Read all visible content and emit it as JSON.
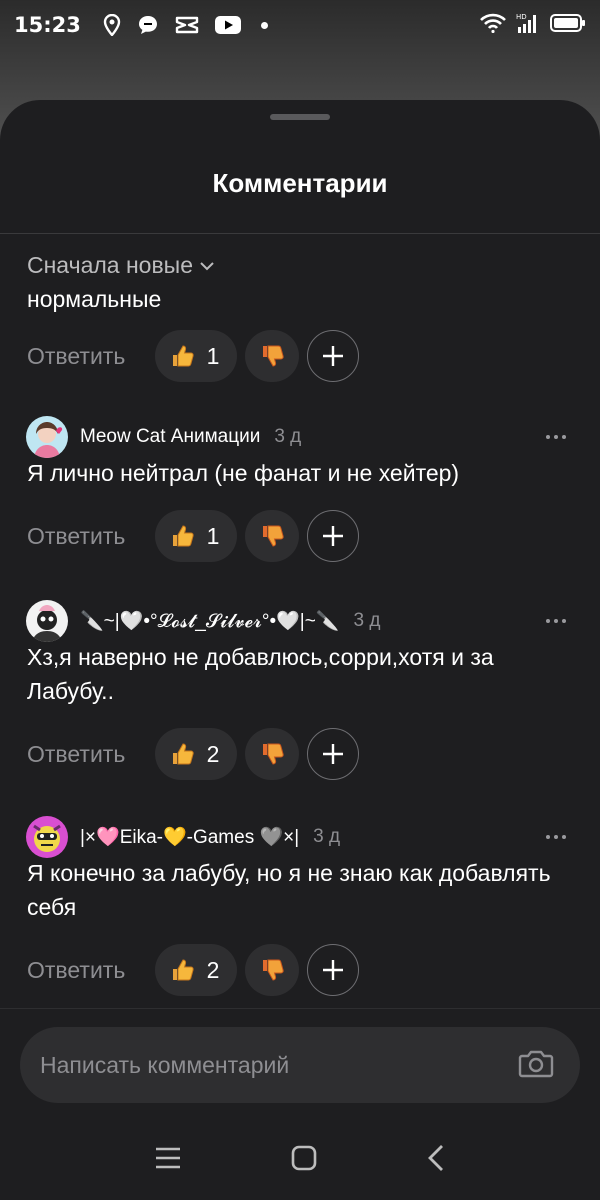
{
  "status_bar": {
    "time": "15:23",
    "icons": [
      "location-icon",
      "message-bubble-icon",
      "capcut-icon",
      "youtube-icon",
      "notification-dot",
      "wifi-icon",
      "hd-signal-icon",
      "battery-icon"
    ]
  },
  "sheet": {
    "title": "Комментарии",
    "sort_label": "Сначала новые"
  },
  "partial_comment": {
    "text_tail": "нормальные",
    "reply_label": "Ответить",
    "likes": "1"
  },
  "comments": [
    {
      "author": "Meow Cat Анимации",
      "time": "3 д",
      "text": "Я лично нейтрал (не фанат и не хейтер)",
      "reply_label": "Ответить",
      "likes": "1"
    },
    {
      "author": "🔪~|🤍•°𝓛𝓸𝓼𝓽_𝓢𝓲𝓵𝓿𝓮𝓻°•🤍|~🔪",
      "time": "3 д",
      "text": "Хз,я наверно не добавлюсь,сорри,хотя и за Лабубу..",
      "reply_label": "Ответить",
      "likes": "2"
    },
    {
      "author": "|×🩷Eika-💛-Games 🩶×|",
      "time": "3 д",
      "text": "Я конечно за лабубу, но я не знаю как добавлять себя",
      "reply_label": "Ответить",
      "likes": "2"
    }
  ],
  "composer": {
    "placeholder": "Написать комментарий"
  },
  "colors": {
    "sheet_bg": "#1e1e20",
    "pill_bg": "#2e2e30",
    "muted_text": "#8e8e92"
  }
}
